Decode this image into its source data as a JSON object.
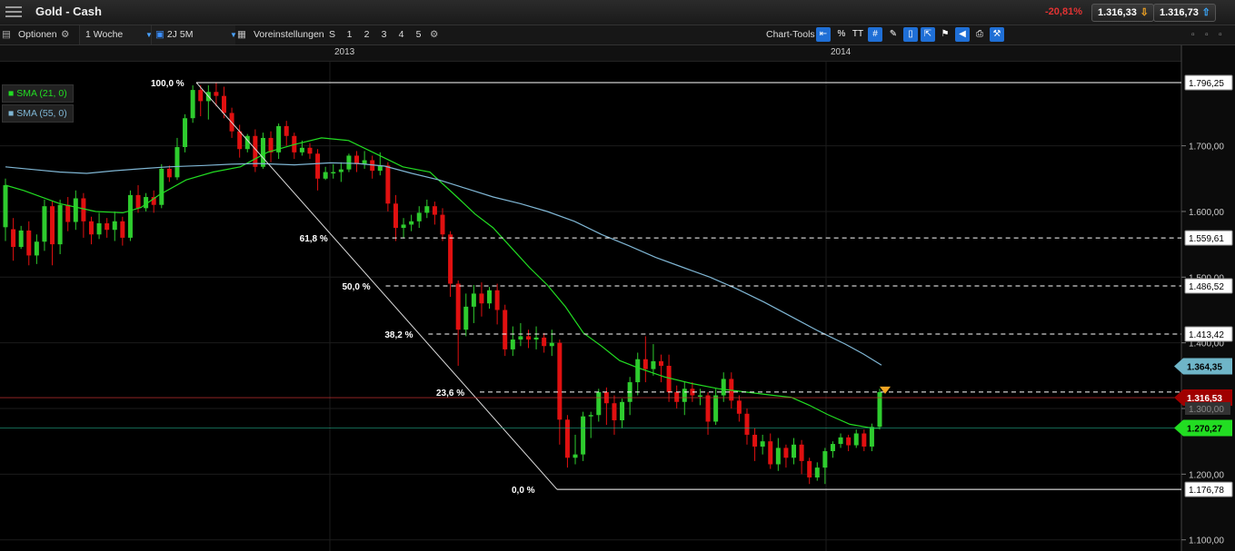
{
  "header": {
    "menu_icon": "hamburger-menu-icon",
    "title": "Gold - Cash",
    "change": "-20,81%",
    "bid": "1.316,33",
    "ask": "1.316,73",
    "change_color": "#e33333"
  },
  "toolbar": {
    "options_label": "Optionen",
    "interval": "1 Woche",
    "range": "2J 5M",
    "presets_label": "Voreinstellungen",
    "periods": [
      "S",
      "1",
      "2",
      "3",
      "4",
      "5"
    ],
    "chart_tools_label": "Chart-Tools",
    "percent_label": "%",
    "text_tool_label": "TT"
  },
  "time_axis": [
    "2013",
    "2014"
  ],
  "legend": [
    {
      "label": "SMA (21, 0)",
      "color": "#22dd22"
    },
    {
      "label": "SMA (55, 0)",
      "color": "#7fb6d4"
    }
  ],
  "chart_data": {
    "type": "candlestick",
    "title": "Gold - Cash",
    "ylim": [
      1083,
      1828
    ],
    "y_ticks": [
      {
        "label": "1.700,00",
        "value": 1700
      },
      {
        "label": "1.600,00",
        "value": 1600
      },
      {
        "label": "1.500,00",
        "value": 1500
      },
      {
        "label": "1.400,00",
        "value": 1400
      },
      {
        "label": "1.300,00",
        "value": 1300
      },
      {
        "label": "1.200,00",
        "value": 1200
      },
      {
        "label": "1.100,00",
        "value": 1100
      }
    ],
    "candles": [
      [
        1576,
        1640,
        1555,
        1650
      ],
      [
        1573,
        1546,
        1525,
        1590
      ],
      [
        1546,
        1571,
        1543,
        1578
      ],
      [
        1571,
        1533,
        1518,
        1585
      ],
      [
        1533,
        1554,
        1520,
        1565
      ],
      [
        1554,
        1608,
        1540,
        1618
      ],
      [
        1608,
        1550,
        1518,
        1615
      ],
      [
        1550,
        1610,
        1535,
        1618
      ],
      [
        1610,
        1584,
        1570,
        1622
      ],
      [
        1584,
        1620,
        1572,
        1632
      ],
      [
        1620,
        1585,
        1560,
        1628
      ],
      [
        1585,
        1565,
        1550,
        1592
      ],
      [
        1565,
        1582,
        1558,
        1598
      ],
      [
        1582,
        1572,
        1560,
        1590
      ],
      [
        1572,
        1585,
        1555,
        1600
      ],
      [
        1585,
        1560,
        1548,
        1592
      ],
      [
        1560,
        1625,
        1555,
        1632
      ],
      [
        1625,
        1605,
        1598,
        1640
      ],
      [
        1605,
        1622,
        1600,
        1628
      ],
      [
        1622,
        1610,
        1598,
        1632
      ],
      [
        1610,
        1665,
        1605,
        1672
      ],
      [
        1665,
        1652,
        1645,
        1670
      ],
      [
        1652,
        1698,
        1648,
        1712
      ],
      [
        1698,
        1742,
        1690,
        1748
      ],
      [
        1742,
        1785,
        1735,
        1792
      ],
      [
        1785,
        1768,
        1745,
        1792
      ],
      [
        1768,
        1782,
        1740,
        1792
      ],
      [
        1782,
        1776,
        1760,
        1796
      ],
      [
        1776,
        1750,
        1742,
        1790
      ],
      [
        1750,
        1722,
        1712,
        1758
      ],
      [
        1722,
        1695,
        1682,
        1732
      ],
      [
        1695,
        1715,
        1690,
        1718
      ],
      [
        1715,
        1668,
        1660,
        1725
      ],
      [
        1668,
        1712,
        1665,
        1720
      ],
      [
        1712,
        1690,
        1675,
        1722
      ],
      [
        1690,
        1730,
        1680,
        1734
      ],
      [
        1730,
        1715,
        1700,
        1738
      ],
      [
        1715,
        1690,
        1680,
        1720
      ],
      [
        1690,
        1697,
        1685,
        1708
      ],
      [
        1697,
        1688,
        1680,
        1704
      ],
      [
        1688,
        1650,
        1632,
        1695
      ],
      [
        1650,
        1660,
        1648,
        1668
      ],
      [
        1660,
        1660,
        1650,
        1672
      ],
      [
        1660,
        1664,
        1645,
        1675
      ],
      [
        1664,
        1685,
        1660,
        1688
      ],
      [
        1685,
        1672,
        1660,
        1692
      ],
      [
        1672,
        1678,
        1665,
        1692
      ],
      [
        1678,
        1662,
        1650,
        1685
      ],
      [
        1662,
        1670,
        1655,
        1690
      ],
      [
        1670,
        1612,
        1600,
        1675
      ],
      [
        1612,
        1575,
        1555,
        1625
      ],
      [
        1575,
        1580,
        1560,
        1590
      ],
      [
        1580,
        1585,
        1570,
        1595
      ],
      [
        1585,
        1598,
        1575,
        1608
      ],
      [
        1598,
        1608,
        1590,
        1618
      ],
      [
        1608,
        1595,
        1580,
        1615
      ],
      [
        1595,
        1565,
        1555,
        1605
      ],
      [
        1565,
        1490,
        1470,
        1570
      ],
      [
        1490,
        1420,
        1365,
        1495
      ],
      [
        1420,
        1455,
        1410,
        1475
      ],
      [
        1455,
        1475,
        1430,
        1488
      ],
      [
        1475,
        1460,
        1440,
        1492
      ],
      [
        1460,
        1480,
        1452,
        1485
      ],
      [
        1480,
        1450,
        1428,
        1490
      ],
      [
        1450,
        1390,
        1380,
        1458
      ],
      [
        1390,
        1405,
        1380,
        1425
      ],
      [
        1405,
        1410,
        1395,
        1430
      ],
      [
        1410,
        1405,
        1392,
        1420
      ],
      [
        1405,
        1408,
        1390,
        1425
      ],
      [
        1408,
        1395,
        1385,
        1415
      ],
      [
        1395,
        1400,
        1380,
        1420
      ],
      [
        1400,
        1283,
        1245,
        1405
      ],
      [
        1283,
        1225,
        1210,
        1290
      ],
      [
        1225,
        1230,
        1215,
        1260
      ],
      [
        1230,
        1288,
        1220,
        1295
      ],
      [
        1288,
        1290,
        1255,
        1295
      ],
      [
        1290,
        1325,
        1280,
        1330
      ],
      [
        1325,
        1308,
        1275,
        1332
      ],
      [
        1308,
        1282,
        1260,
        1320
      ],
      [
        1282,
        1310,
        1270,
        1315
      ],
      [
        1310,
        1340,
        1290,
        1348
      ],
      [
        1340,
        1375,
        1320,
        1385
      ],
      [
        1375,
        1360,
        1340,
        1410
      ],
      [
        1360,
        1372,
        1350,
        1398
      ],
      [
        1372,
        1365,
        1340,
        1382
      ],
      [
        1365,
        1325,
        1310,
        1382
      ],
      [
        1325,
        1310,
        1300,
        1335
      ],
      [
        1310,
        1330,
        1290,
        1340
      ],
      [
        1330,
        1320,
        1310,
        1340
      ],
      [
        1320,
        1320,
        1305,
        1330
      ],
      [
        1320,
        1280,
        1260,
        1325
      ],
      [
        1280,
        1320,
        1275,
        1330
      ],
      [
        1320,
        1345,
        1310,
        1355
      ],
      [
        1345,
        1312,
        1300,
        1355
      ],
      [
        1312,
        1292,
        1280,
        1320
      ],
      [
        1292,
        1260,
        1245,
        1300
      ],
      [
        1260,
        1242,
        1220,
        1270
      ],
      [
        1242,
        1250,
        1230,
        1260
      ],
      [
        1250,
        1215,
        1208,
        1262
      ],
      [
        1215,
        1240,
        1205,
        1255
      ],
      [
        1240,
        1225,
        1210,
        1245
      ],
      [
        1225,
        1245,
        1215,
        1255
      ],
      [
        1245,
        1220,
        1200,
        1252
      ],
      [
        1220,
        1195,
        1185,
        1225
      ],
      [
        1195,
        1210,
        1190,
        1218
      ],
      [
        1210,
        1235,
        1185,
        1240
      ],
      [
        1235,
        1246,
        1225,
        1250
      ],
      [
        1246,
        1256,
        1240,
        1262
      ],
      [
        1256,
        1244,
        1235,
        1260
      ],
      [
        1244,
        1262,
        1240,
        1268
      ],
      [
        1262,
        1242,
        1235,
        1268
      ],
      [
        1242,
        1272,
        1235,
        1277
      ],
      [
        1272,
        1325,
        1268,
        1330
      ]
    ],
    "series": [
      {
        "name": "SMA (21, 0)",
        "color": "#22dd22",
        "points": [
          [
            0,
            1640
          ],
          [
            20,
            1632
          ],
          [
            60,
            1612
          ],
          [
            100,
            1600
          ],
          [
            130,
            1598
          ],
          [
            150,
            1606
          ],
          [
            170,
            1625
          ],
          [
            200,
            1648
          ],
          [
            230,
            1660
          ],
          [
            260,
            1668
          ],
          [
            290,
            1690
          ],
          [
            320,
            1702
          ],
          [
            350,
            1712
          ],
          [
            380,
            1708
          ],
          [
            410,
            1688
          ],
          [
            440,
            1668
          ],
          [
            470,
            1660
          ],
          [
            500,
            1622
          ],
          [
            520,
            1596
          ],
          [
            540,
            1575
          ],
          [
            560,
            1545
          ],
          [
            580,
            1515
          ],
          [
            600,
            1488
          ],
          [
            620,
            1455
          ],
          [
            640,
            1415
          ],
          [
            660,
            1395
          ],
          [
            680,
            1373
          ],
          [
            700,
            1362
          ],
          [
            730,
            1348
          ],
          [
            760,
            1338
          ],
          [
            790,
            1330
          ],
          [
            820,
            1325
          ],
          [
            850,
            1320
          ],
          [
            870,
            1317
          ],
          [
            890,
            1305
          ],
          [
            910,
            1291
          ],
          [
            935,
            1276
          ],
          [
            960,
            1270
          ],
          [
            968,
            1270
          ]
        ]
      },
      {
        "name": "SMA (55, 0)",
        "color": "#7fb6d4",
        "points": [
          [
            0,
            1668
          ],
          [
            30,
            1664
          ],
          [
            60,
            1660
          ],
          [
            90,
            1658
          ],
          [
            120,
            1662
          ],
          [
            150,
            1665
          ],
          [
            180,
            1668
          ],
          [
            220,
            1670
          ],
          [
            250,
            1672
          ],
          [
            280,
            1673
          ],
          [
            320,
            1671
          ],
          [
            360,
            1674
          ],
          [
            390,
            1673
          ],
          [
            420,
            1669
          ],
          [
            450,
            1658
          ],
          [
            480,
            1648
          ],
          [
            510,
            1635
          ],
          [
            540,
            1622
          ],
          [
            570,
            1612
          ],
          [
            600,
            1600
          ],
          [
            630,
            1585
          ],
          [
            660,
            1565
          ],
          [
            690,
            1548
          ],
          [
            720,
            1530
          ],
          [
            750,
            1515
          ],
          [
            780,
            1500
          ],
          [
            810,
            1482
          ],
          [
            840,
            1462
          ],
          [
            870,
            1440
          ],
          [
            900,
            1418
          ],
          [
            930,
            1398
          ],
          [
            950,
            1383
          ],
          [
            970,
            1366
          ]
        ]
      }
    ],
    "fibonacci": [
      {
        "label": "100,0 %",
        "value": 1796.25,
        "price_label": "1.796,25"
      },
      {
        "label": "61,8 %",
        "value": 1559.61,
        "price_label": "1.559,61"
      },
      {
        "label": "50,0 %",
        "value": 1486.52,
        "price_label": "1.486,52"
      },
      {
        "label": "38,2 %",
        "value": 1413.42,
        "price_label": "1.413,42"
      },
      {
        "label": "23,6 %",
        "value": 1325.0,
        "price_label": ""
      },
      {
        "label": "0,0 %",
        "value": 1176.78,
        "price_label": "1.176,78"
      }
    ],
    "markers": [
      {
        "label": "1.364,35",
        "value": 1364.35,
        "color": "#6fb5c8"
      },
      {
        "label": "1.316,53",
        "value": 1316.53,
        "color": "#a00000"
      },
      {
        "label": "1.270,27",
        "value": 1270.27,
        "color": "#22dd22"
      },
      {
        "label": "1.300,00",
        "value": 1300,
        "color": "#444444"
      }
    ]
  }
}
